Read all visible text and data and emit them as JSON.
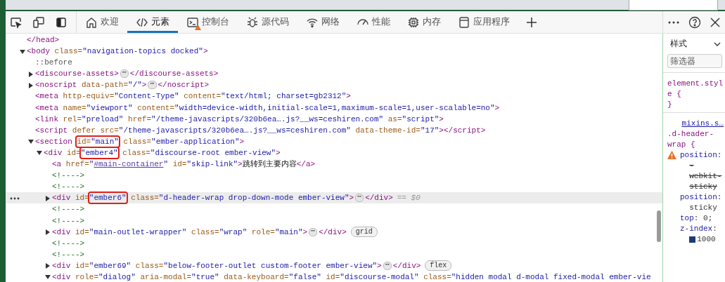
{
  "toolbar": {
    "tabs": [
      {
        "label": "欢迎",
        "selected": false,
        "warning": false
      },
      {
        "label": "元素",
        "selected": true,
        "warning": false
      },
      {
        "label": "控制台",
        "selected": false,
        "warning": true
      },
      {
        "label": "源代码",
        "selected": false,
        "warning": false
      },
      {
        "label": "网络",
        "selected": false,
        "warning": false
      },
      {
        "label": "性能",
        "selected": false,
        "warning": false
      },
      {
        "label": "内存",
        "selected": false,
        "warning": false
      },
      {
        "label": "应用程序",
        "selected": false,
        "warning": false
      }
    ]
  },
  "dom_tree": [
    {
      "selected": false,
      "parts": [
        {
          "kind": "tag",
          "text": "</head>"
        }
      ]
    },
    {
      "selected": false,
      "expanded": true,
      "parts": [
        {
          "kind": "tag",
          "text": "<body"
        },
        {
          "kind": "attr",
          "text": " class="
        },
        {
          "kind": "value",
          "text": "\"navigation-topics docked\""
        },
        {
          "kind": "tag",
          "text": ">"
        }
      ],
      "children": [
        {
          "selected": false,
          "parts": [
            {
              "kind": "pseudo",
              "text": "::before"
            }
          ]
        },
        {
          "selected": false,
          "expanded": false,
          "parts": [
            {
              "kind": "tag",
              "text": "<discourse-assets>"
            },
            {
              "kind": "more",
              "text": "⋯"
            },
            {
              "kind": "tag",
              "text": "</discourse-assets>"
            }
          ]
        },
        {
          "selected": false,
          "expanded": false,
          "parts": [
            {
              "kind": "tag",
              "text": "<noscript"
            },
            {
              "kind": "attr",
              "text": " data-path="
            },
            {
              "kind": "value",
              "text": "\"/\""
            },
            {
              "kind": "tag",
              "text": ">"
            },
            {
              "kind": "more",
              "text": "⋯"
            },
            {
              "kind": "tag",
              "text": "</noscript>"
            }
          ]
        },
        {
          "selected": false,
          "parts": [
            {
              "kind": "tag",
              "text": "<meta"
            },
            {
              "kind": "attr",
              "text": " http-equiv="
            },
            {
              "kind": "value",
              "text": "\"Content-Type\""
            },
            {
              "kind": "attr",
              "text": " content="
            },
            {
              "kind": "value",
              "text": "\"text/html; charset=gb2312\""
            },
            {
              "kind": "tag",
              "text": ">"
            }
          ]
        },
        {
          "selected": false,
          "parts": [
            {
              "kind": "tag",
              "text": "<meta"
            },
            {
              "kind": "attr",
              "text": " name="
            },
            {
              "kind": "value",
              "text": "\"viewport\""
            },
            {
              "kind": "attr",
              "text": " content="
            },
            {
              "kind": "value",
              "text": "\"width=device-width,initial-scale=1,maximum-scale=1,user-scalable=no\""
            },
            {
              "kind": "tag",
              "text": ">"
            }
          ]
        },
        {
          "selected": false,
          "parts": [
            {
              "kind": "tag",
              "text": "<link"
            },
            {
              "kind": "attr",
              "text": " rel="
            },
            {
              "kind": "value",
              "text": "\"preload\""
            },
            {
              "kind": "attr",
              "text": " href="
            },
            {
              "kind": "value",
              "text": "\"/theme-javascripts/320b6ea….js?__ws=ceshiren.com\""
            },
            {
              "kind": "attr",
              "text": " as="
            },
            {
              "kind": "value",
              "text": "\"script\""
            },
            {
              "kind": "tag",
              "text": ">"
            }
          ]
        },
        {
          "selected": false,
          "parts": [
            {
              "kind": "tag",
              "text": "<script"
            },
            {
              "kind": "attr",
              "text": " defer src="
            },
            {
              "kind": "value",
              "text": "\"/theme-javascripts/320b6ea….js?__ws=ceshiren.com\""
            },
            {
              "kind": "attr",
              "text": " data-theme-id="
            },
            {
              "kind": "value",
              "text": "\"17\""
            },
            {
              "kind": "tag",
              "text": "></script>"
            }
          ]
        },
        {
          "selected": false,
          "expanded": true,
          "parts": [
            {
              "kind": "tag",
              "text": "<section "
            },
            {
              "kind": "attr",
              "text": "id=",
              "boxed": true
            },
            {
              "kind": "value",
              "text": "\"main\"",
              "boxed": true
            },
            {
              "kind": "attr",
              "text": " class="
            },
            {
              "kind": "value",
              "text": "\"ember-application\""
            },
            {
              "kind": "tag",
              "text": ">"
            }
          ],
          "children": [
            {
              "selected": false,
              "expanded": true,
              "parts": [
                {
                  "kind": "tag",
                  "text": "<div"
                },
                {
                  "kind": "attr",
                  "text": " id="
                },
                {
                  "kind": "value",
                  "text": "\"ember4\"",
                  "boxed": true
                },
                {
                  "kind": "attr",
                  "text": " class="
                },
                {
                  "kind": "value",
                  "text": "\"discourse-root ember-view\""
                },
                {
                  "kind": "tag",
                  "text": ">"
                }
              ],
              "children": [
                {
                  "selected": false,
                  "parts": [
                    {
                      "kind": "tag",
                      "text": "<a"
                    },
                    {
                      "kind": "attr",
                      "text": " href="
                    },
                    {
                      "kind": "value",
                      "text": "\""
                    },
                    {
                      "kind": "link",
                      "text": "#main-container"
                    },
                    {
                      "kind": "value",
                      "text": "\""
                    },
                    {
                      "kind": "attr",
                      "text": " id="
                    },
                    {
                      "kind": "value",
                      "text": "\"skip-link\""
                    },
                    {
                      "kind": "tag",
                      "text": ">"
                    },
                    {
                      "kind": "text",
                      "text": "跳转到主要内容"
                    },
                    {
                      "kind": "tag",
                      "text": "</a>"
                    }
                  ]
                },
                {
                  "selected": false,
                  "parts": [
                    {
                      "kind": "comment",
                      "text": "<!---->"
                    }
                  ]
                },
                {
                  "selected": false,
                  "parts": [
                    {
                      "kind": "comment",
                      "text": "<!---->"
                    }
                  ]
                },
                {
                  "selected": true,
                  "expanded": false,
                  "parts": [
                    {
                      "kind": "tag",
                      "text": "<div"
                    },
                    {
                      "kind": "attr",
                      "text": " id="
                    },
                    {
                      "kind": "value",
                      "text": "\"ember6\"",
                      "boxed": true
                    },
                    {
                      "kind": "attr",
                      "text": " class="
                    },
                    {
                      "kind": "value",
                      "text": "\"d-header-wrap drop-down-mode ember-view\""
                    },
                    {
                      "kind": "tag",
                      "text": ">"
                    },
                    {
                      "kind": "more",
                      "text": "⋯"
                    },
                    {
                      "kind": "tag",
                      "text": "</div>"
                    },
                    {
                      "kind": "note",
                      "text": "== $0"
                    }
                  ]
                },
                {
                  "selected": false,
                  "parts": [
                    {
                      "kind": "comment",
                      "text": "<!---->"
                    }
                  ]
                },
                {
                  "selected": false,
                  "parts": [
                    {
                      "kind": "comment",
                      "text": "<!---->"
                    }
                  ]
                },
                {
                  "selected": false,
                  "expanded": false,
                  "parts": [
                    {
                      "kind": "tag",
                      "text": "<div"
                    },
                    {
                      "kind": "attr",
                      "text": " id="
                    },
                    {
                      "kind": "value",
                      "text": "\"main-outlet-wrapper\""
                    },
                    {
                      "kind": "attr",
                      "text": " class="
                    },
                    {
                      "kind": "value",
                      "text": "\"wrap\""
                    },
                    {
                      "kind": "attr",
                      "text": " role="
                    },
                    {
                      "kind": "value",
                      "text": "\"main\""
                    },
                    {
                      "kind": "tag",
                      "text": ">"
                    },
                    {
                      "kind": "more",
                      "text": "⋯"
                    },
                    {
                      "kind": "tag",
                      "text": "</div>"
                    },
                    {
                      "kind": "badge",
                      "text": "grid"
                    }
                  ]
                },
                {
                  "selected": false,
                  "parts": [
                    {
                      "kind": "comment",
                      "text": "<!---->"
                    }
                  ]
                },
                {
                  "selected": false,
                  "parts": [
                    {
                      "kind": "comment",
                      "text": "<!---->"
                    }
                  ]
                },
                {
                  "selected": false,
                  "expanded": false,
                  "parts": [
                    {
                      "kind": "tag",
                      "text": "<div"
                    },
                    {
                      "kind": "attr",
                      "text": " id="
                    },
                    {
                      "kind": "value",
                      "text": "\"ember69\""
                    },
                    {
                      "kind": "attr",
                      "text": " class="
                    },
                    {
                      "kind": "value",
                      "text": "\"below-footer-outlet custom-footer ember-view\""
                    },
                    {
                      "kind": "tag",
                      "text": ">"
                    },
                    {
                      "kind": "more",
                      "text": "⋯"
                    },
                    {
                      "kind": "tag",
                      "text": "</div>"
                    },
                    {
                      "kind": "badge",
                      "text": "flex"
                    }
                  ]
                },
                {
                  "selected": false,
                  "expanded": true,
                  "parts": [
                    {
                      "kind": "tag",
                      "text": "<div"
                    },
                    {
                      "kind": "attr",
                      "text": " role="
                    },
                    {
                      "kind": "value",
                      "text": "\"dialog\""
                    },
                    {
                      "kind": "attr",
                      "text": " aria-modal="
                    },
                    {
                      "kind": "value",
                      "text": "\"true\""
                    },
                    {
                      "kind": "attr",
                      "text": " data-keyboard="
                    },
                    {
                      "kind": "value",
                      "text": "\"false\""
                    },
                    {
                      "kind": "attr",
                      "text": " id="
                    },
                    {
                      "kind": "value",
                      "text": "\"discourse-modal\""
                    },
                    {
                      "kind": "attr",
                      "text": " class="
                    },
                    {
                      "kind": "value",
                      "text": "\"hidden modal d-modal fixed-modal ember-vie"
                    }
                  ]
                }
              ]
            }
          ]
        }
      ]
    }
  ],
  "styles_panel": {
    "tab": {
      "label": "样式",
      "selected": true
    },
    "filter": {
      "placeholder": "筛选器"
    },
    "rules": [
      {
        "selector": "element.style {",
        "closing": "}"
      },
      {
        "source": "mixins.s…",
        "selector": ".d-header-wrap {",
        "declarations": [
          {
            "property": "position",
            "separator": ":",
            "value": "-webkit-sticky",
            "overridden": true,
            "warning": true
          },
          {
            "property": "position",
            "separator": ":",
            "value": "sticky",
            "overridden": false,
            "warning": false
          },
          {
            "property": "top",
            "separator": ":",
            "value": "0;",
            "overridden": false,
            "warning": false
          },
          {
            "property": "z-index",
            "separator": ":",
            "value": "1000",
            "overridden": false,
            "warning": false,
            "swatch": true
          }
        ]
      }
    ]
  }
}
